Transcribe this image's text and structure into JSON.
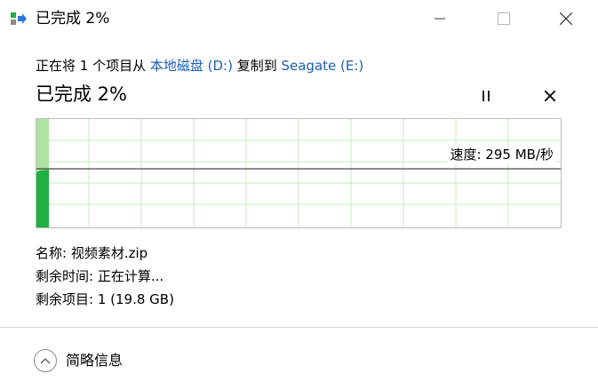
{
  "window": {
    "title": "已完成 2%",
    "icon": "file-copy-icon",
    "controls": [
      "minimize-icon",
      "maximize-icon",
      "close-icon"
    ]
  },
  "copy": {
    "prefix": "正在将 1 个项目从 ",
    "source": "本地磁盘 (D:)",
    "middle": " 复制到 ",
    "destination": "Seagate (E:)",
    "link_color": "#1a5fb4"
  },
  "progress": {
    "heading": "已完成 2%",
    "percent": 2,
    "pause_icon": "pause-icon",
    "cancel_icon": "cancel-icon"
  },
  "graph": {
    "speed_label": "速度: 295 MB/秒",
    "bar_color": "#1fb141",
    "fill_color": "#aee3a4",
    "grid_color": "#c9eac3"
  },
  "details": {
    "name": "名称: 视频素材.zip",
    "time_remaining": "剩余时间: 正在计算...",
    "items_remaining": "剩余项目: 1 (19.8 GB)"
  },
  "footer": {
    "toggle_label": "简略信息",
    "toggle_icon": "chevron-up-icon"
  }
}
